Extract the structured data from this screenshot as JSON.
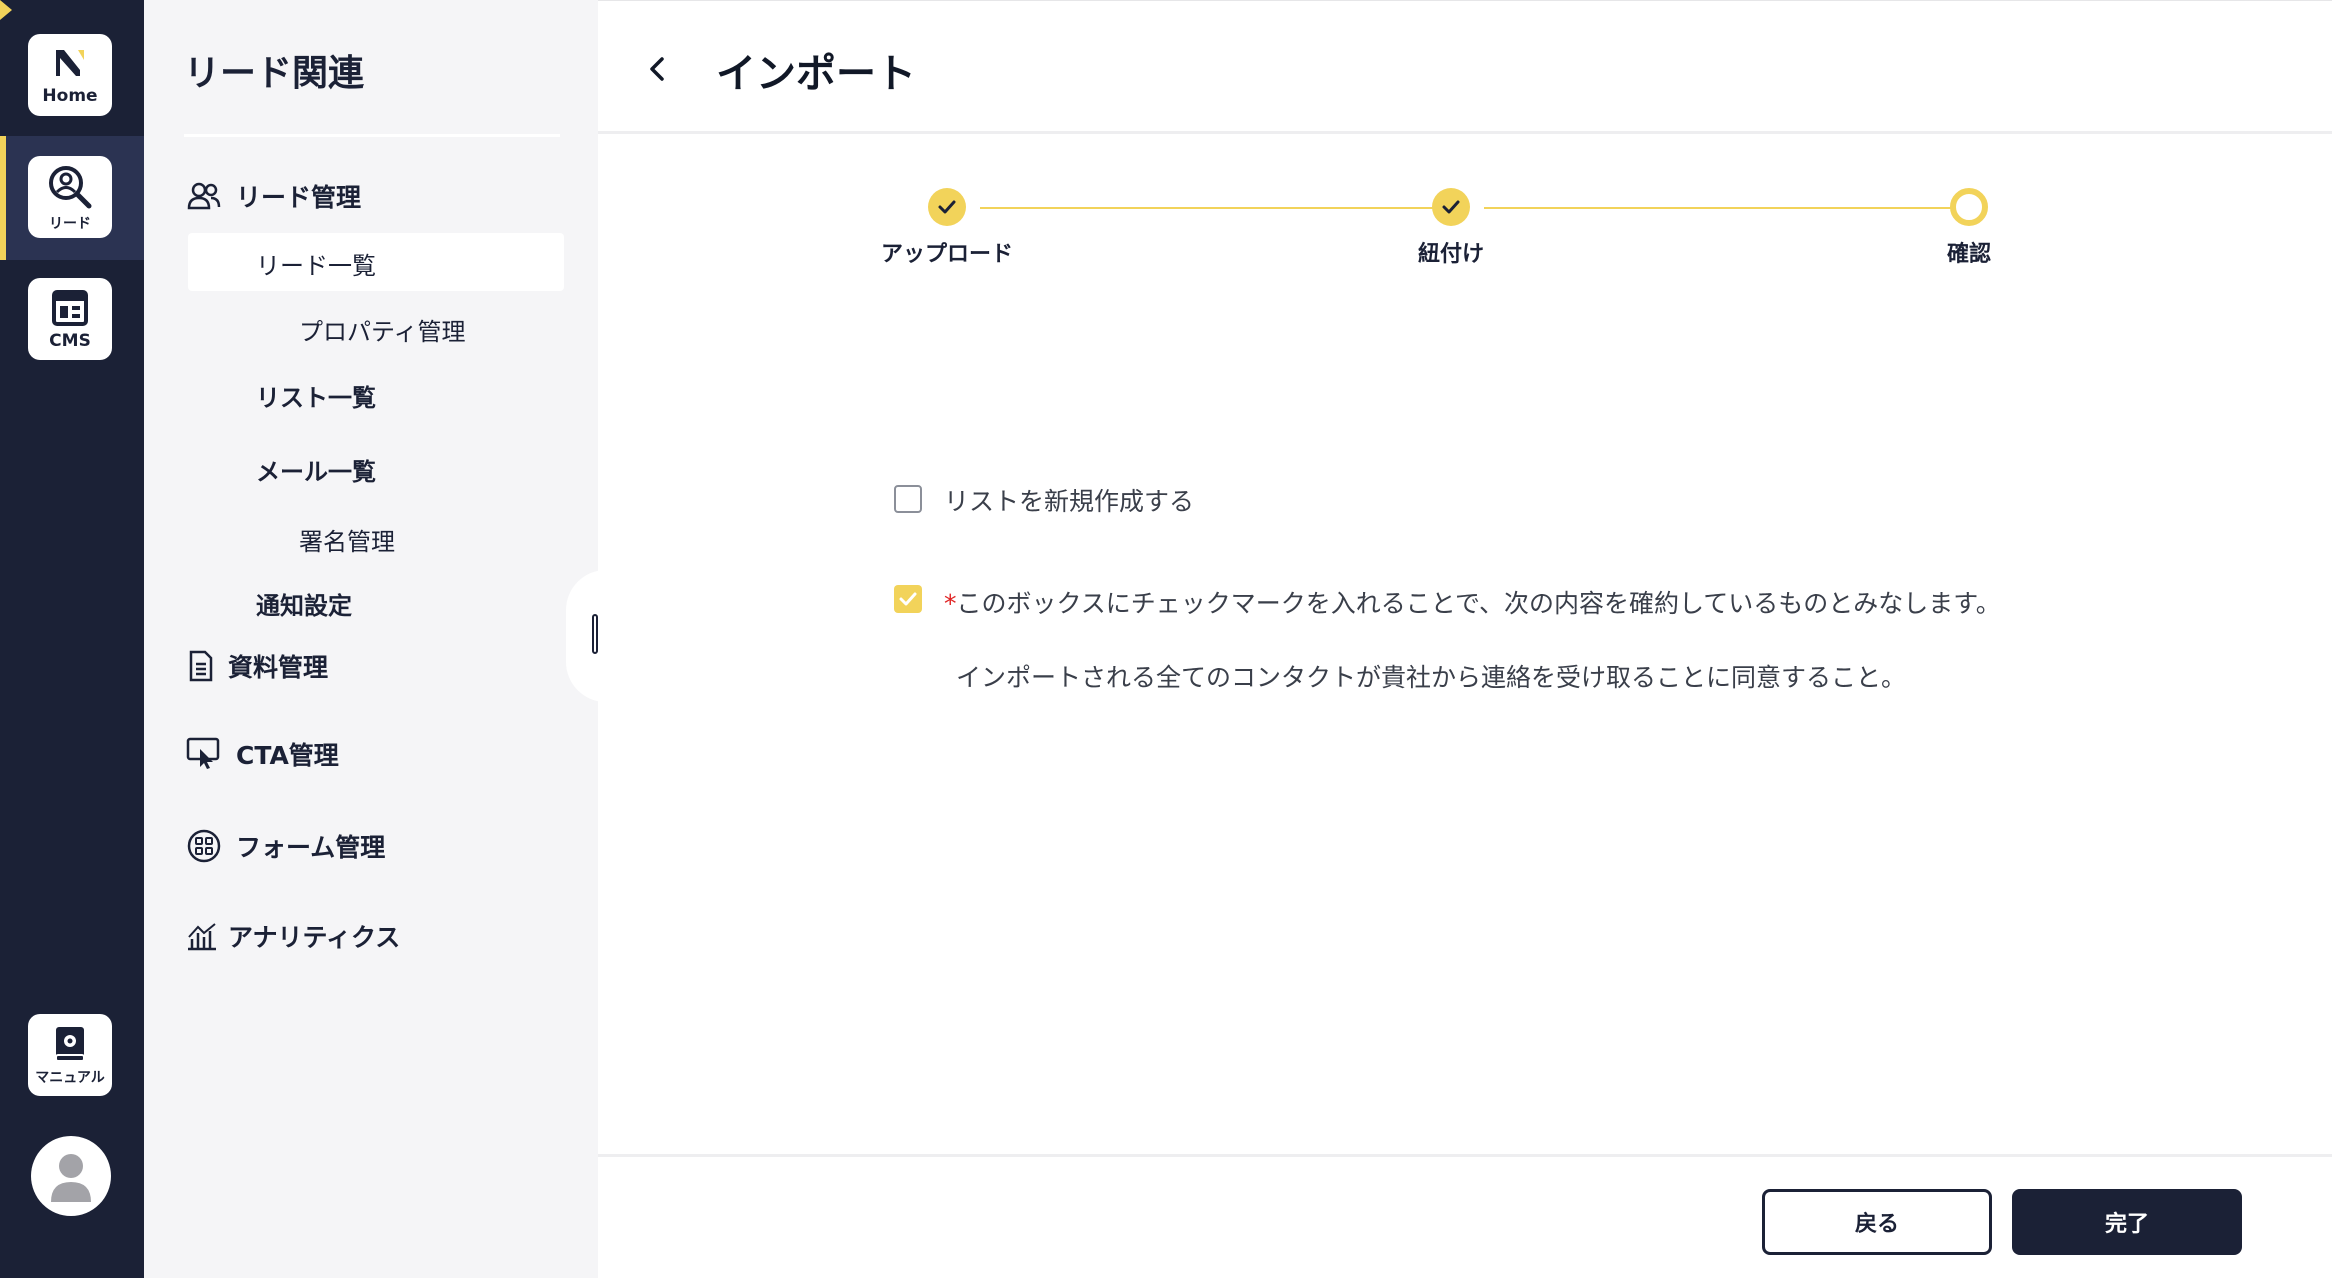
{
  "rail": {
    "home_label": "Home",
    "lead_label": "リード",
    "cms_label": "CMS",
    "manual_label": "マニュアル"
  },
  "sidebar": {
    "title": "リード関連",
    "items": {
      "lead_management": "リード管理",
      "lead_list": "リード一覧",
      "property_management": "プロパティ管理",
      "list_list": "リスト一覧",
      "mail_list": "メール一覧",
      "signature_management": "署名管理",
      "notification_settings": "通知設定",
      "document_management": "資料管理",
      "cta_management": "CTA管理",
      "form_management": "フォーム管理",
      "analytics": "アナリティクス"
    }
  },
  "header": {
    "title": "インポート"
  },
  "stepper": {
    "steps": [
      {
        "label": "アップロード",
        "state": "done"
      },
      {
        "label": "紐付け",
        "state": "done"
      },
      {
        "label": "確認",
        "state": "current"
      }
    ]
  },
  "options": {
    "new_list_label": "リストを新規作成する",
    "new_list_checked": false,
    "consent_required_mark": "*",
    "consent_label": "このボックスにチェックマークを入れることで、次の内容を確約しているものとみなします。",
    "consent_checked": true,
    "consent_detail": "インポートされる全てのコンタクトが貴社から連絡を受け取ることに同意すること。"
  },
  "footer": {
    "back_label": "戻る",
    "finish_label": "完了"
  },
  "colors": {
    "navy": "#1b2136",
    "accent": "#f2d35a",
    "required": "#e02424"
  }
}
